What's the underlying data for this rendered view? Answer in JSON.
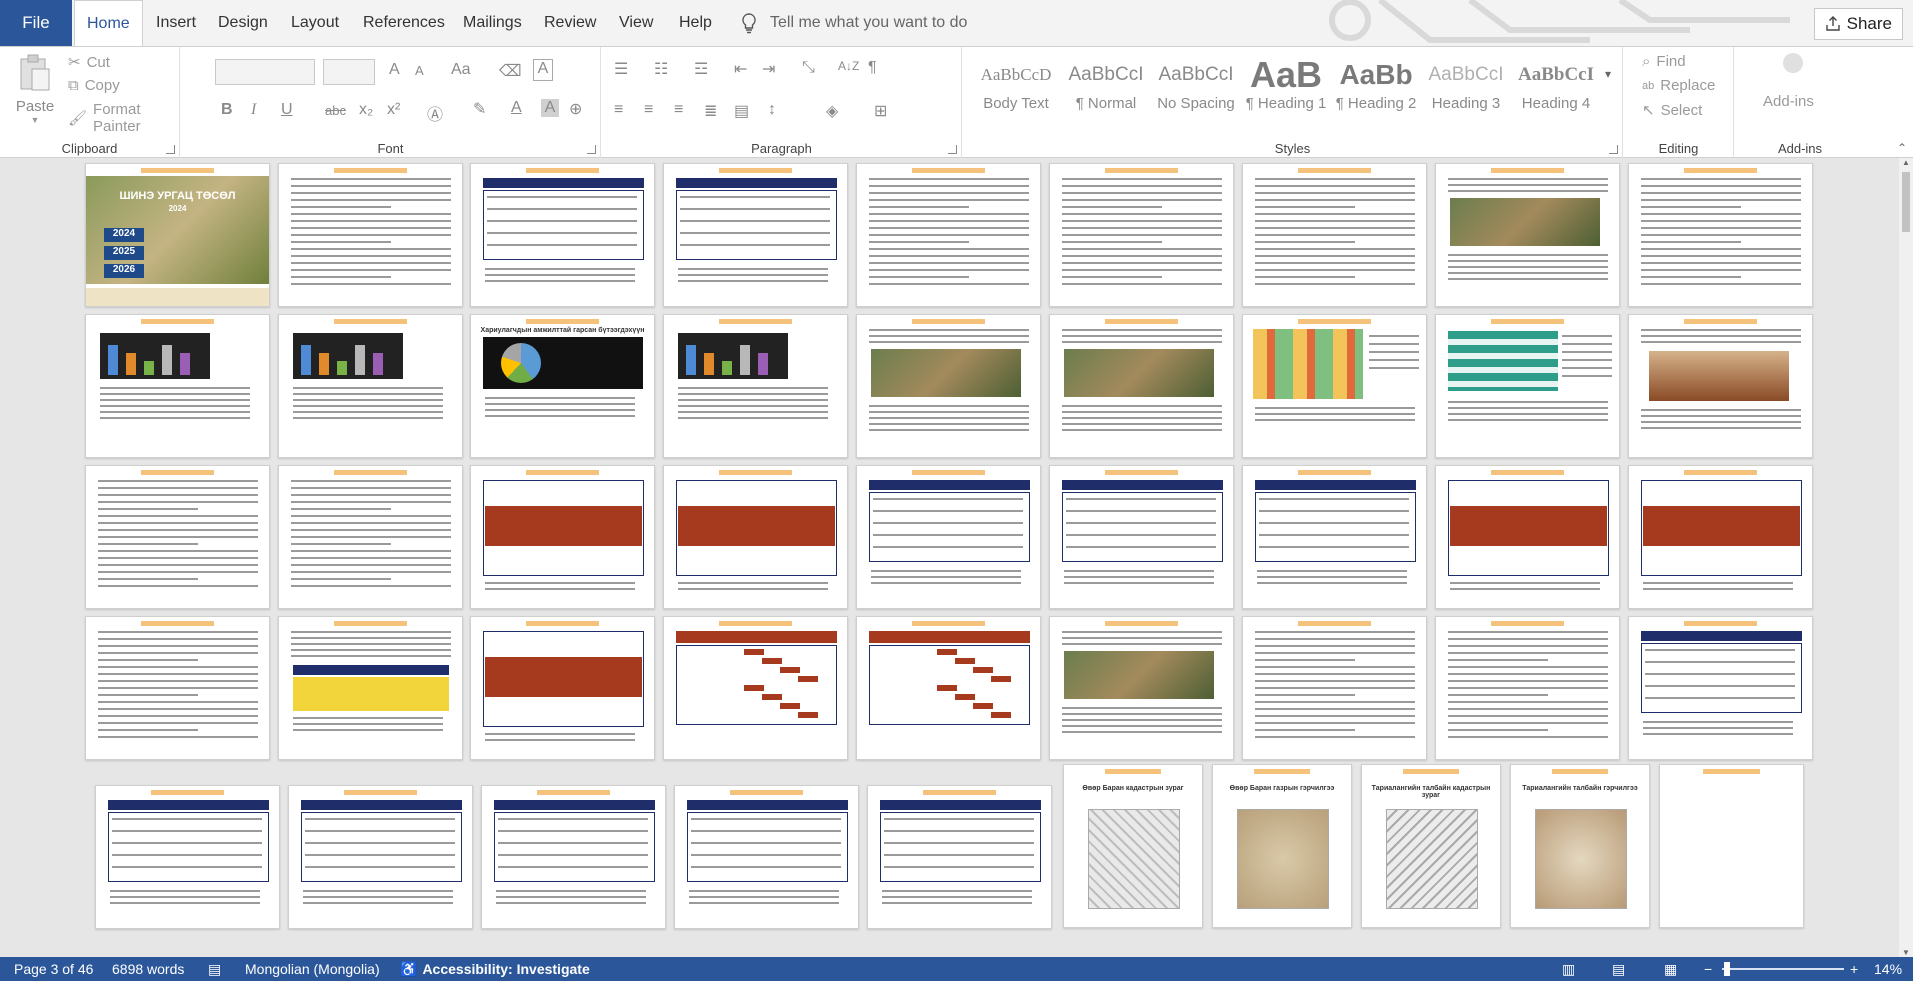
{
  "ribbon_tabs": {
    "file": "File",
    "home": "Home",
    "insert": "Insert",
    "design": "Design",
    "layout": "Layout",
    "references": "References",
    "mailings": "Mailings",
    "review": "Review",
    "view": "View",
    "help": "Help"
  },
  "tell_me": {
    "placeholder": "Tell me what you want to do",
    "icon": "lightbulb-icon"
  },
  "share": {
    "label": "Share",
    "icon": "share-icon"
  },
  "clipboard": {
    "label": "Clipboard",
    "paste": "Paste",
    "cut": "Cut",
    "copy": "Copy",
    "format_painter": "Format Painter"
  },
  "font": {
    "label": "Font",
    "bold": "B",
    "italic": "I",
    "underline": "U",
    "strikethrough": "abc",
    "subscript": "x₂",
    "superscript": "x²",
    "change_case": "Aa",
    "grow": "A",
    "shrink": "A"
  },
  "paragraph": {
    "label": "Paragraph",
    "sort": "A↓Z",
    "show_marks": "¶"
  },
  "styles": {
    "label": "Styles",
    "items": [
      {
        "sample": "AaBbCcD",
        "name": "Body Text"
      },
      {
        "sample": "AaBbCcI",
        "name": "¶ Normal"
      },
      {
        "sample": "AaBbCcI",
        "name": "No Spacing"
      },
      {
        "sample": "AaB",
        "name": "¶ Heading 1"
      },
      {
        "sample": "AaBb",
        "name": "¶ Heading 2"
      },
      {
        "sample": "AaBbCcI",
        "name": "Heading 3"
      },
      {
        "sample": "AaBbCcI",
        "name": "Heading 4"
      }
    ]
  },
  "editing": {
    "label": "Editing",
    "find": "Find",
    "replace": "Replace",
    "select": "Select"
  },
  "addins": {
    "label": "Add-ins",
    "button": "Add-ins"
  },
  "document": {
    "cover_title": "ШИНЭ УРГАЦ ТӨСӨЛ",
    "cover_year": "2024",
    "years": [
      "2024",
      "2025",
      "2026"
    ],
    "chart_title": "Хариулагчдын амжилттай гарсан бүтээгдэхүүн",
    "map_caption_1": "Өвөр Баран кадастрын зураг",
    "map_caption_2": "Өвөр Баран газрын гэрчилгээ",
    "map_caption_3": "Тариалангийн талбайн кадастрын зураг",
    "map_caption_4": "Тариалангийн талбайн гэрчилгээ"
  },
  "status": {
    "page": "Page 3 of 46",
    "words": "6898 words",
    "language": "Mongolian (Mongolia)",
    "accessibility": "Accessibility: Investigate",
    "zoom": "14%"
  },
  "colors": {
    "accent": "#2b579a",
    "table_navy": "#1f2d6b",
    "table_brick": "#a63a1f",
    "header_band": "#f5c27b"
  }
}
